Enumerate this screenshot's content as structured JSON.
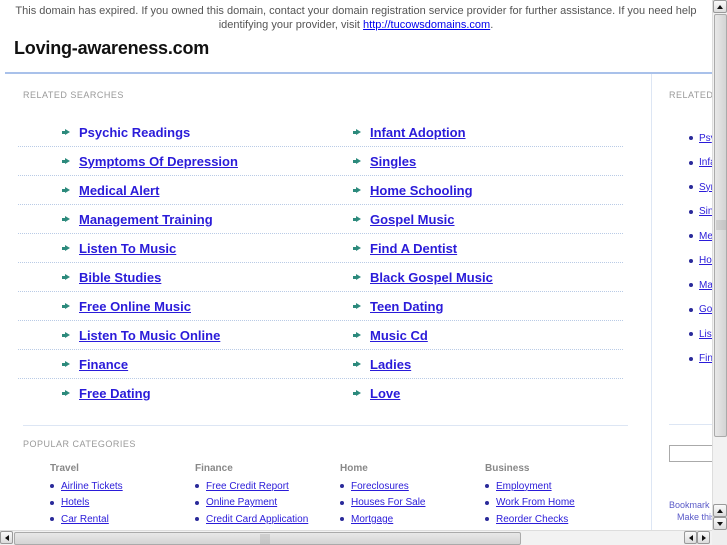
{
  "notice": {
    "text": "This domain has expired. If you owned this domain, contact your domain registration service provider for further assistance. If you need help identifying your provider, visit ",
    "link_text": "http://tucowsdomains.com",
    "suffix": "."
  },
  "site_title": "Loving-awareness.com",
  "related_searches": {
    "label": "RELATED SEARCHES",
    "rows": [
      [
        "Psychic Readings",
        "Infant Adoption"
      ],
      [
        "Symptoms Of Depression",
        "Singles"
      ],
      [
        "Medical Alert",
        "Home Schooling"
      ],
      [
        "Management Training",
        "Gospel Music"
      ],
      [
        "Listen To Music",
        "Find A Dentist"
      ],
      [
        "Bible Studies",
        "Black Gospel Music"
      ],
      [
        "Free Online Music",
        "Teen Dating"
      ],
      [
        "Listen To Music Online",
        "Music Cd"
      ],
      [
        "Finance",
        "Ladies"
      ],
      [
        "Free Dating",
        "Love"
      ]
    ]
  },
  "popular_categories": {
    "label": "POPULAR CATEGORIES",
    "columns": [
      {
        "title": "Travel",
        "items": [
          "Airline Tickets",
          "Hotels",
          "Car Rental"
        ]
      },
      {
        "title": "Finance",
        "items": [
          "Free Credit Report",
          "Online Payment",
          "Credit Card Application"
        ]
      },
      {
        "title": "Home",
        "items": [
          "Foreclosures",
          "Houses For Sale",
          "Mortgage"
        ]
      },
      {
        "title": "Business",
        "items": [
          "Employment",
          "Work From Home",
          "Reorder Checks"
        ]
      }
    ]
  },
  "sidebar": {
    "label": "RELATED SEARCHES",
    "items": [
      "Psychic Readings",
      "Infant Adoption",
      "Symptoms Of Depression",
      "Singles",
      "Medical Alert",
      "Home Schooling",
      "Management Training",
      "Gospel Music",
      "Listen To Music",
      "Finance"
    ],
    "search_value": "",
    "bookmark_text": "Bookmark this page",
    "make_this_text": "Make this your homepage"
  }
}
